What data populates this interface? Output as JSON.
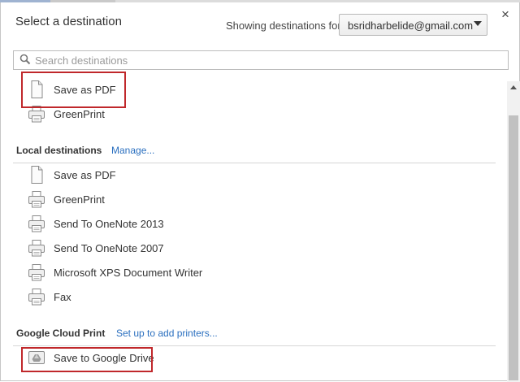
{
  "dialog": {
    "title": "Select a destination",
    "close_glyph": "×",
    "showing_label": "Showing destinations for",
    "account": "bsridharbelide@gmail.com"
  },
  "search": {
    "placeholder": "Search destinations",
    "value": ""
  },
  "recent": [
    {
      "label": "Save as PDF",
      "icon": "pdf-page-icon"
    },
    {
      "label": "GreenPrint",
      "icon": "printer-icon"
    }
  ],
  "local": {
    "title": "Local destinations",
    "link": "Manage...",
    "items": [
      {
        "label": "Save as PDF",
        "icon": "pdf-page-icon"
      },
      {
        "label": "GreenPrint",
        "icon": "printer-icon"
      },
      {
        "label": "Send To OneNote 2013",
        "icon": "printer-icon"
      },
      {
        "label": "Send To OneNote 2007",
        "icon": "printer-icon"
      },
      {
        "label": "Microsoft XPS Document Writer",
        "icon": "printer-icon"
      },
      {
        "label": "Fax",
        "icon": "printer-icon"
      }
    ]
  },
  "cloud": {
    "title": "Google Cloud Print",
    "link": "Set up to add printers...",
    "items": [
      {
        "label": "Save to Google Drive",
        "icon": "google-drive-icon"
      }
    ]
  },
  "colors": {
    "highlight": "#c0282b",
    "link": "#2a6fbf"
  }
}
